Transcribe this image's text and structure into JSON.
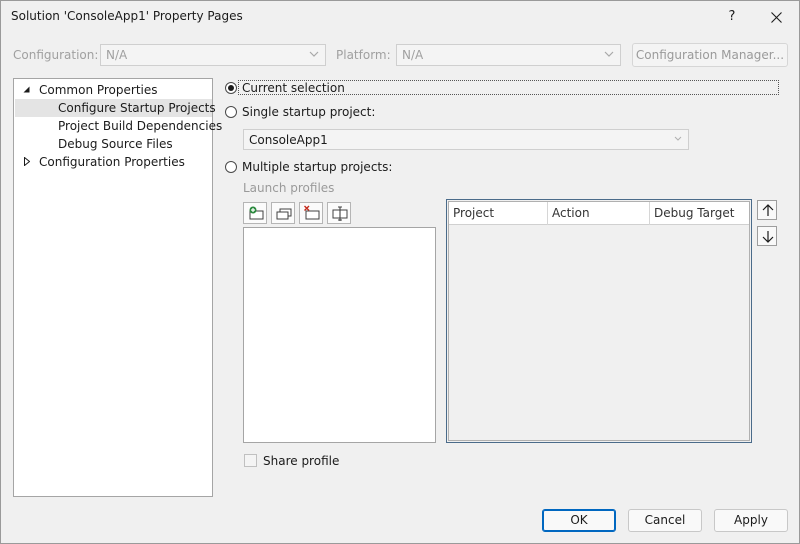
{
  "window": {
    "title": "Solution 'ConsoleApp1' Property Pages",
    "help_label": "?"
  },
  "config_bar": {
    "configuration_label": "Configuration:",
    "configuration_value": "N/A",
    "platform_label": "Platform:",
    "platform_value": "N/A",
    "config_manager_label": "Configuration Manager..."
  },
  "tree": {
    "items": [
      {
        "label": "Common Properties",
        "expanded": true
      },
      {
        "label": "Configure Startup Projects",
        "selected": true
      },
      {
        "label": "Project Build Dependencies"
      },
      {
        "label": "Debug Source Files"
      },
      {
        "label": "Configuration Properties",
        "expanded": false
      }
    ]
  },
  "startup": {
    "current_selection_label": "Current selection",
    "current_selection_checked": true,
    "single_project_label": "Single startup project:",
    "single_project_value": "ConsoleApp1",
    "multiple_projects_label": "Multiple startup projects:",
    "launch_profiles_label": "Launch profiles",
    "grid_columns": [
      "Project",
      "Action",
      "Debug Target"
    ],
    "share_profile_label": "Share profile",
    "share_profile_checked": false
  },
  "footer": {
    "ok_label": "OK",
    "cancel_label": "Cancel",
    "apply_label": "Apply"
  },
  "icons": [
    "close-icon",
    "chevron-down-icon",
    "expand-arrow-icon",
    "collapse-arrow-icon",
    "add-profile-icon",
    "duplicate-profile-icon",
    "remove-profile-icon",
    "rename-profile-icon",
    "move-up-icon",
    "move-down-icon"
  ]
}
